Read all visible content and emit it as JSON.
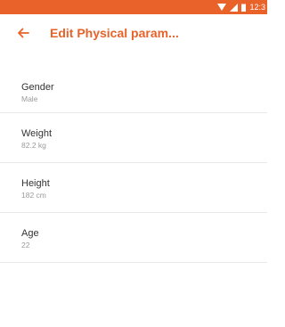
{
  "status_bar": {
    "time": "12:3",
    "color": "#e8622a",
    "icons": [
      "wifi-icon",
      "signal-icon",
      "battery-icon"
    ]
  },
  "app_bar": {
    "back_icon": "arrow-left-icon",
    "title": "Edit Physical param..."
  },
  "params": [
    {
      "label": "Gender",
      "value": "Male"
    },
    {
      "label": "Weight",
      "value": "82.2 kg"
    },
    {
      "label": "Height",
      "value": "182 cm"
    },
    {
      "label": "Age",
      "value": "22"
    }
  ]
}
